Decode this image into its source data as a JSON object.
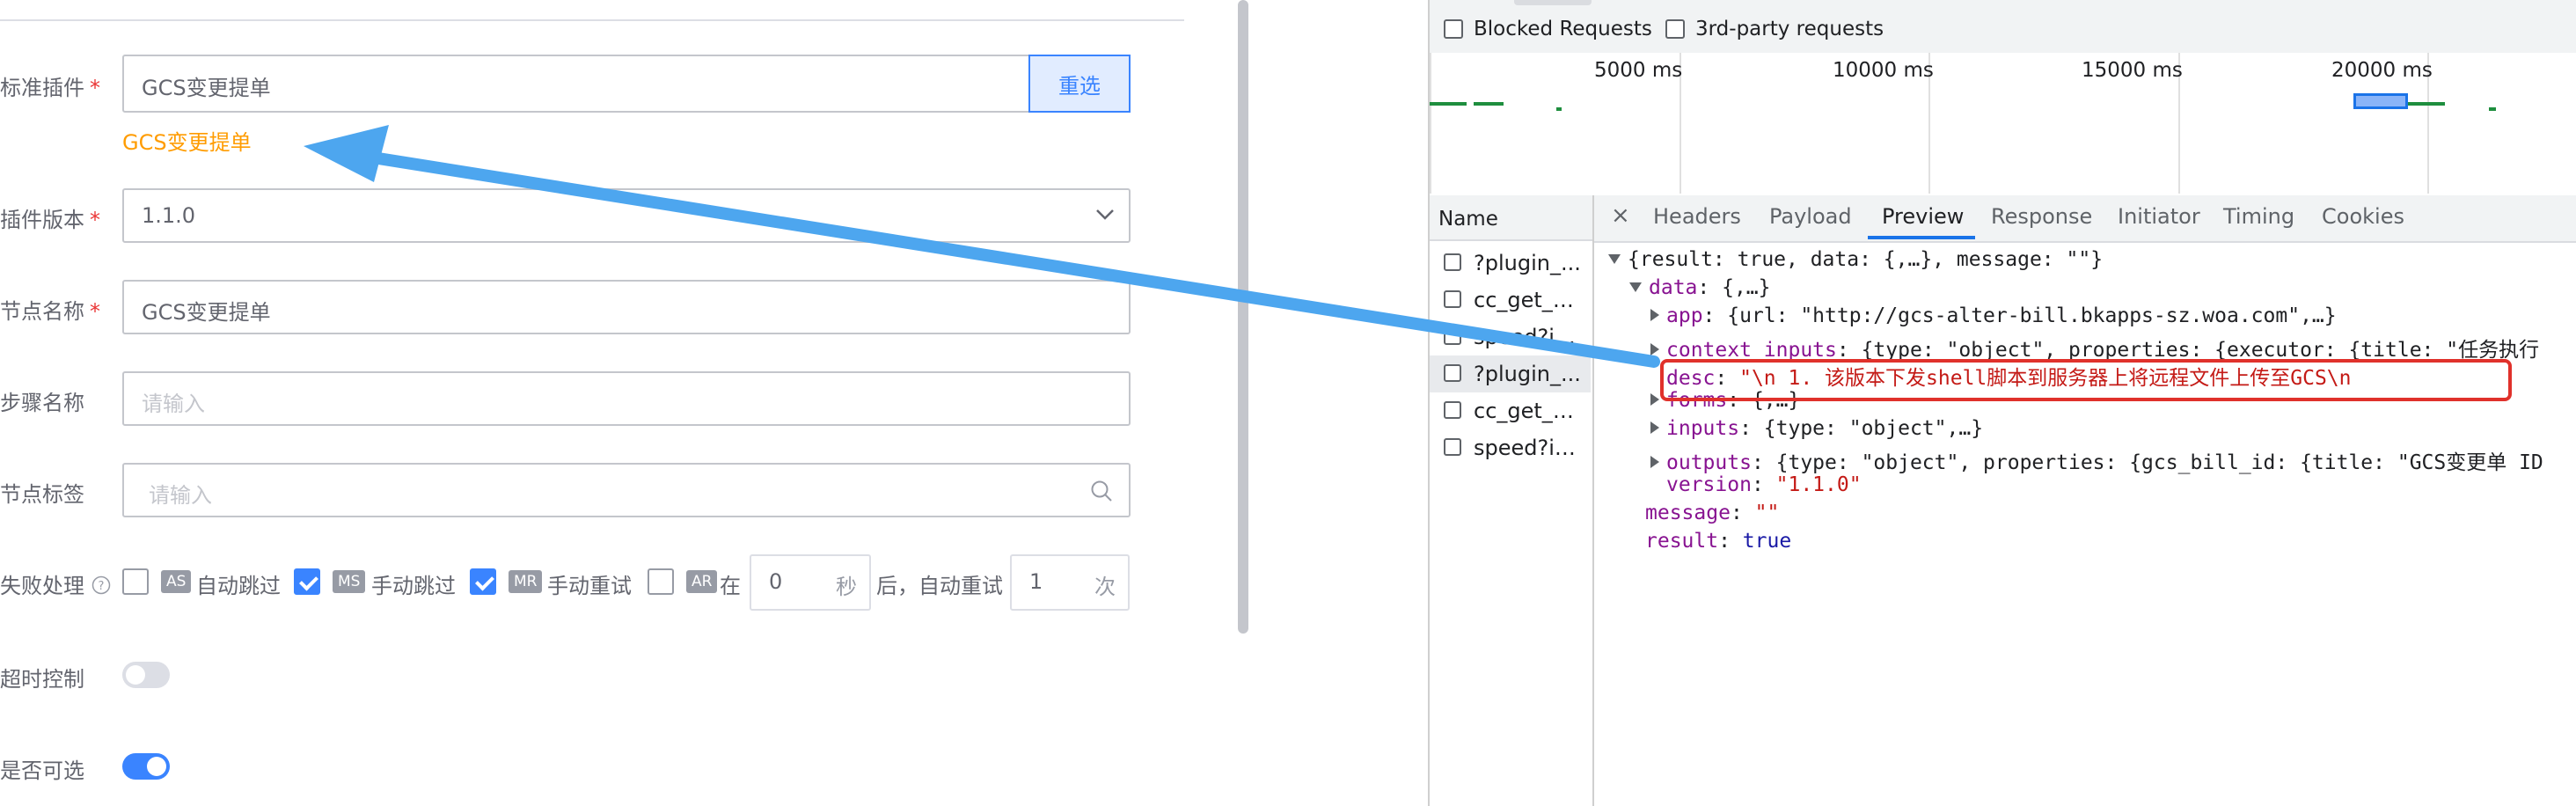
{
  "form": {
    "plugin": {
      "label": "标准插件",
      "value": "GCS变更提单",
      "button": "重选",
      "hint": "GCS变更提单"
    },
    "version": {
      "label": "插件版本",
      "value": "1.1.0"
    },
    "node_name": {
      "label": "节点名称",
      "value": "GCS变更提单"
    },
    "step_name": {
      "label": "步骤名称",
      "placeholder": "请输入"
    },
    "node_tag": {
      "label": "节点标签",
      "placeholder": "请输入"
    },
    "failure": {
      "label": "失败处理",
      "options": [
        {
          "tag": "AS",
          "text": "自动跳过",
          "checked": false
        },
        {
          "tag": "MS",
          "text": "手动跳过",
          "checked": true
        },
        {
          "tag": "MR",
          "text": "手动重试",
          "checked": true
        },
        {
          "tag": "AR",
          "text": "在",
          "checked": false
        }
      ],
      "seconds_value": "0",
      "seconds_unit": "秒",
      "after_text": "后，自动重试",
      "times_value": "1",
      "times_unit": "次"
    },
    "timeout": {
      "label": "超时控制",
      "on": false
    },
    "optional": {
      "label": "是否可选",
      "on": true
    }
  },
  "devtools": {
    "filters": {
      "blocked": "Blocked Requests",
      "third_party": "3rd-party requests"
    },
    "timeline": [
      "5000 ms",
      "10000 ms",
      "15000 ms",
      "20000 ms"
    ],
    "name_header": "Name",
    "close": "×",
    "tabs": [
      "Headers",
      "Payload",
      "Preview",
      "Response",
      "Initiator",
      "Timing",
      "Cookies"
    ],
    "active_tab": "Preview",
    "requests": [
      "?plugin_...",
      "cc_get_b...",
      "speed?id...",
      "?plugin_...",
      "cc_get_b...",
      "speed?id..."
    ],
    "preview": {
      "root": "{result: true, data: {,…}, message: \"\"}",
      "data_key": "data",
      "data_val": "{,…}",
      "app_key": "app",
      "app_val": "{url: \"http://gcs-alter-bill.bkapps-sz.woa.com\",…}",
      "ctx_key": "context_inputs",
      "ctx_val": "{type: \"object\", properties: {executor: {title: \"任务执行",
      "desc_key": "desc",
      "desc_val": "\"\\n        1. 该版本下发shell脚本到服务器上将远程文件上传至GCS\\n",
      "forms_key": "forms",
      "forms_val": "{,…}",
      "inputs_key": "inputs",
      "inputs_val": "{type: \"object\",…}",
      "outputs_key": "outputs",
      "outputs_val": "{type: \"object\", properties: {gcs_bill_id: {title: \"GCS变更单 ID",
      "version_key": "version",
      "version_val": "\"1.1.0\"",
      "message_key": "message",
      "message_val": "\"\"",
      "result_key": "result",
      "result_val": "true"
    }
  },
  "colors": {
    "primary": "#3a84ff",
    "required": "#ea3636",
    "hint": "#ff9c01",
    "annotation_arrow": "#4da6ef",
    "annotation_box": "#e0312b"
  }
}
